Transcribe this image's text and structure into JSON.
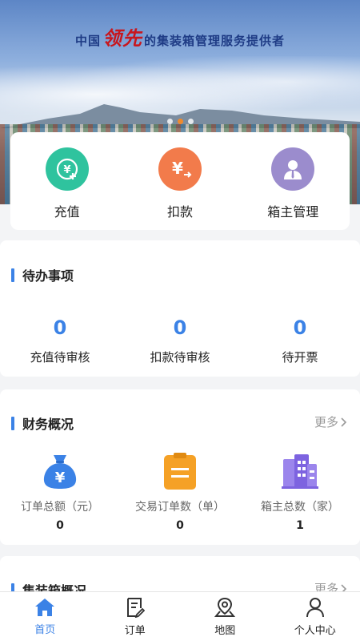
{
  "banner": {
    "slogan_prefix": "中国",
    "slogan_emphasis": "领先",
    "slogan_suffix": "的集装箱管理服务提供者",
    "active_slide": 2,
    "slide_count": 3
  },
  "quick_actions": [
    {
      "label": "充值",
      "icon": "recharge-icon",
      "color": "#2fc39e"
    },
    {
      "label": "扣款",
      "icon": "deduct-icon",
      "color": "#f27b4b"
    },
    {
      "label": "箱主管理",
      "icon": "owner-manage-icon",
      "color": "#9b8ccd"
    }
  ],
  "todo": {
    "title": "待办事项",
    "items": [
      {
        "value": "0",
        "label": "充值待审核"
      },
      {
        "value": "0",
        "label": "扣款待审核"
      },
      {
        "value": "0",
        "label": "待开票"
      }
    ]
  },
  "finance": {
    "title": "财务概况",
    "more": "更多",
    "items": [
      {
        "label": "订单总额（元）",
        "value": "0",
        "icon": "money-bag-icon",
        "color": "#3b82e6"
      },
      {
        "label": "交易订单数（单）",
        "value": "0",
        "icon": "clipboard-icon",
        "color": "#f5a126"
      },
      {
        "label": "箱主总数（家）",
        "value": "1",
        "icon": "buildings-icon",
        "color": "#7d63e0"
      }
    ]
  },
  "container": {
    "title": "集装箱概况",
    "more": "更多"
  },
  "nav": {
    "items": [
      {
        "label": "首页",
        "icon": "home-icon"
      },
      {
        "label": "订单",
        "icon": "order-icon"
      },
      {
        "label": "地图",
        "icon": "map-icon"
      },
      {
        "label": "个人中心",
        "icon": "user-icon"
      }
    ],
    "active": "首页"
  },
  "colors": {
    "accent": "#3b82e6",
    "slogan_blue": "#1e3b85",
    "slogan_red": "#c8161d",
    "active_dot": "#f08a2c"
  }
}
